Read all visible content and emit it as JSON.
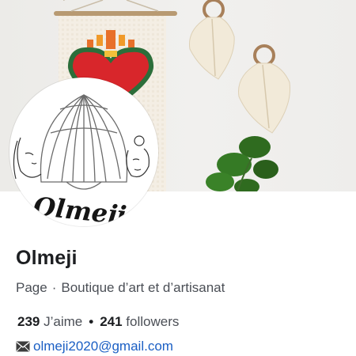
{
  "profile": {
    "name": "Olmeji",
    "logo_text": "Olmeji",
    "category_type": "Page",
    "separator": "·",
    "category": "Boutique d’art et d’artisanat"
  },
  "stats": {
    "likes_count": "239",
    "likes_label": "J’aime",
    "separator": "•",
    "followers_count": "241",
    "followers_label": "followers"
  },
  "contact": {
    "email": "olmeji2020@gmail.com"
  },
  "icons": {
    "email": "envelope-icon"
  },
  "colors": {
    "link": "#1b5fc4",
    "heart": "#d8262b",
    "leaves": "#2f6b1f"
  }
}
